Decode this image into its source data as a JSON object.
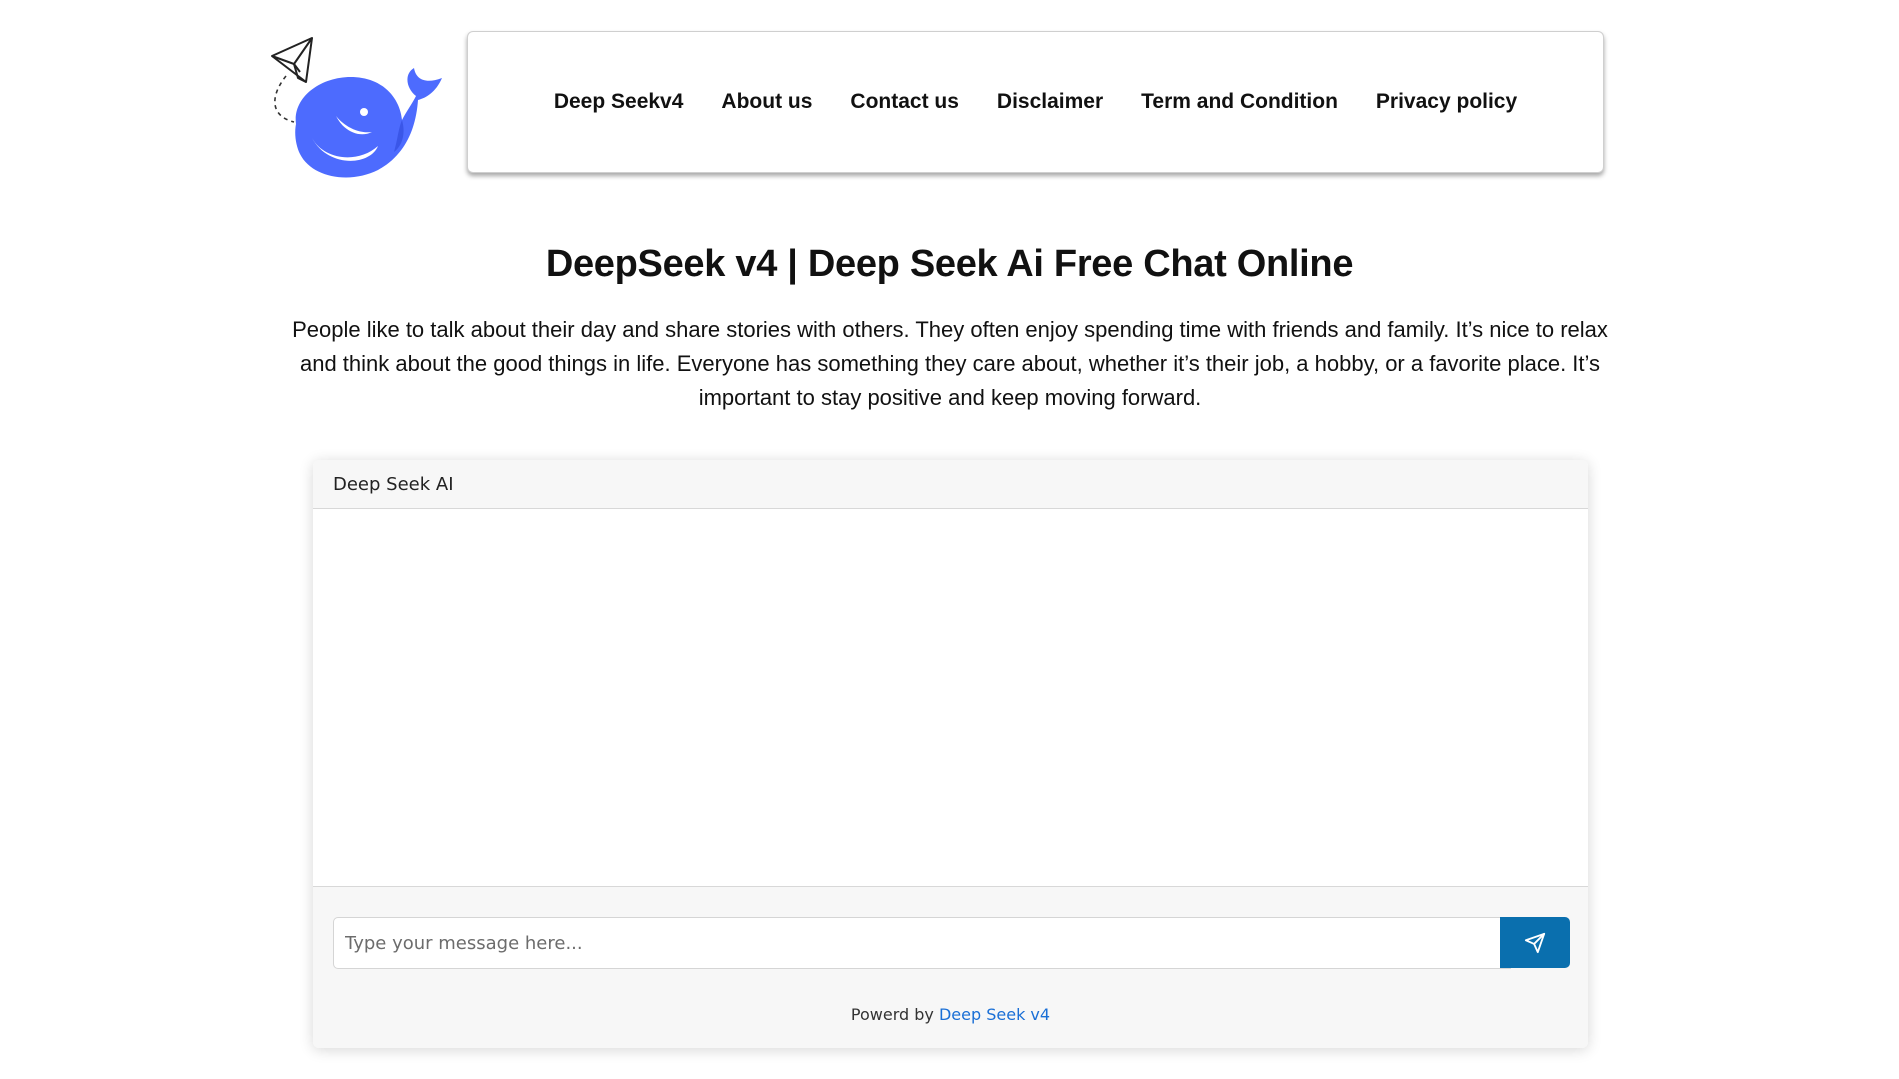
{
  "header": {
    "nav_items": [
      {
        "label": "Deep Seekv4"
      },
      {
        "label": "About us"
      },
      {
        "label": "Contact us"
      },
      {
        "label": "Disclaimer"
      },
      {
        "label": "Term and Condition"
      },
      {
        "label": "Privacy policy"
      }
    ]
  },
  "hero": {
    "title": "DeepSeek v4 | Deep Seek Ai Free Chat Online",
    "intro": "People like to talk about their day and share stories with others. They often enjoy spending time with friends and family. It’s nice to relax and think about the good things in life. Everyone has something they care about, whether it’s their job, a hobby, or a favorite place. It’s important to stay positive and keep moving forward."
  },
  "chat": {
    "header_title": "Deep Seek AI",
    "input_placeholder": "Type your message here...",
    "input_value": "",
    "send_icon": "send-icon",
    "powered_prefix": "Powerd by",
    "powered_link": "Deep Seek v4"
  },
  "colors": {
    "brand_blue": "#4d6bfe",
    "send_button": "#0a6fae",
    "link": "#1a6fd6"
  }
}
